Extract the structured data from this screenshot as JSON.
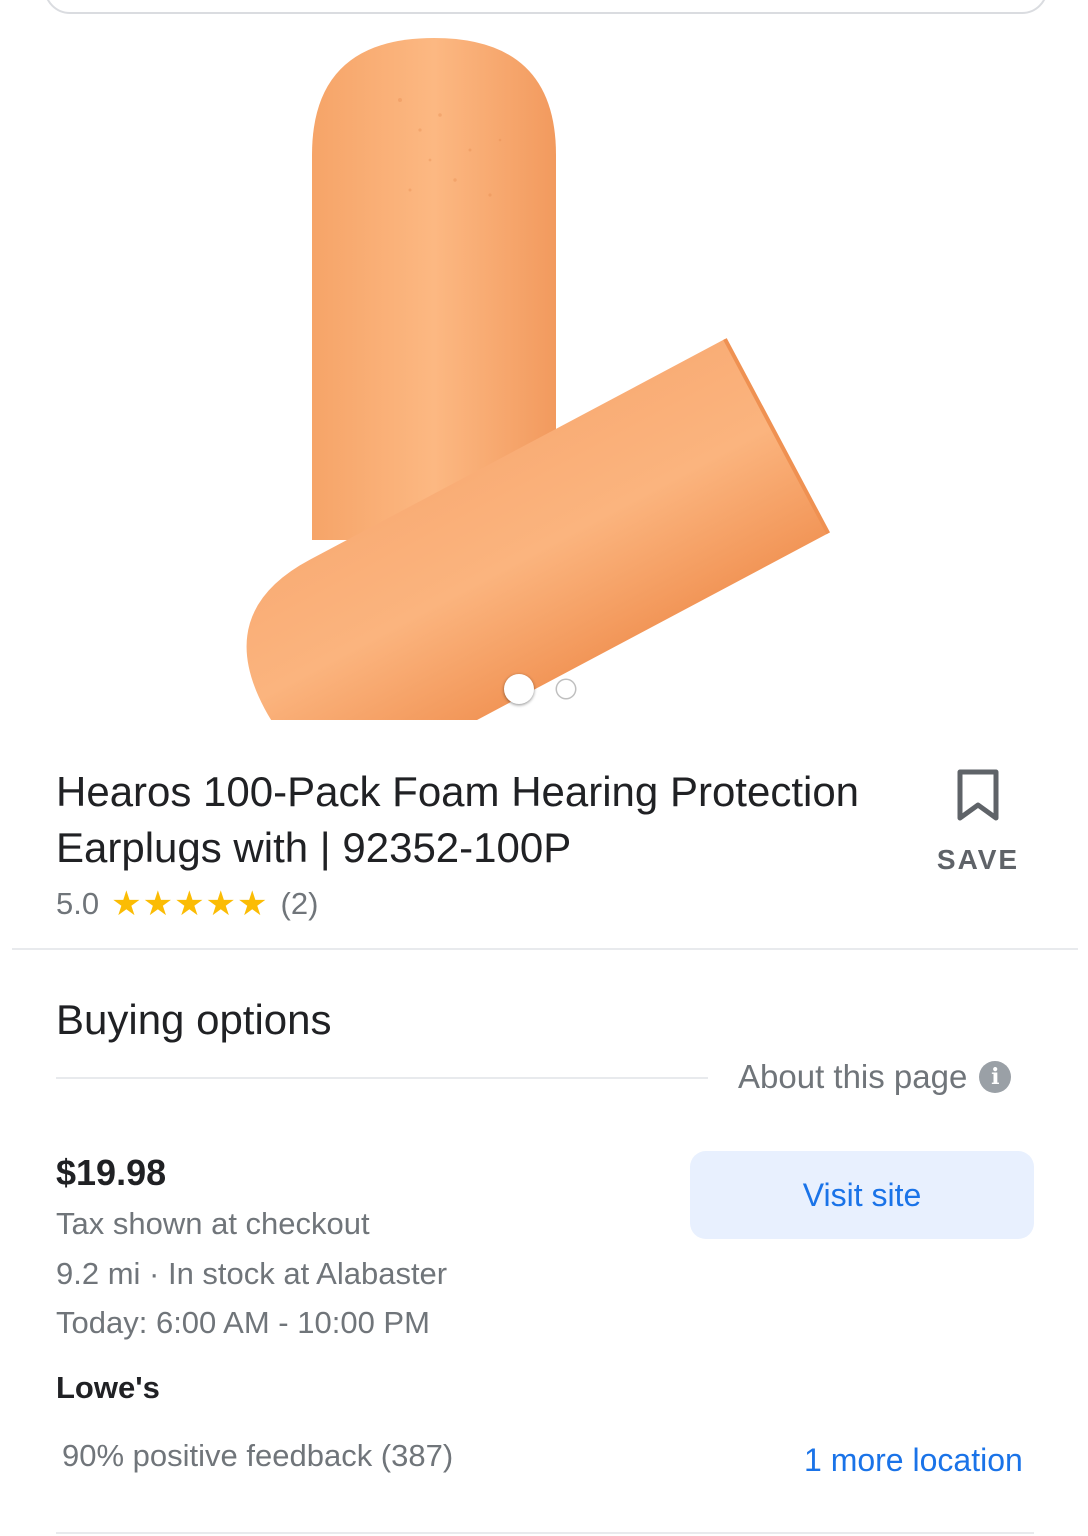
{
  "product": {
    "image_alt": "orange foam earplugs",
    "title": "Hearos 100-Pack Foam Hearing Protection Earplugs with | 92352-100P",
    "rating": "5.0",
    "stars": "★★★★★",
    "review_count": "(2)",
    "save_label": "SAVE",
    "carousel": {
      "total": 2,
      "active": 1
    }
  },
  "buying": {
    "section_title": "Buying options",
    "about_label": "About this page",
    "offer": {
      "price": "$19.98",
      "tax_note": "Tax shown at checkout",
      "stock": "9.2 mi · In stock at Alabaster",
      "hours": "Today: 6:00 AM - 10:00 PM",
      "visit_label": "Visit site",
      "seller": "Lowe's",
      "feedback": "90% positive feedback (387)",
      "more_locations": "1 more location"
    }
  },
  "colors": {
    "accent": "#1a73e8",
    "star": "#fbbc04",
    "button_bg": "#e8f0fe",
    "earplug": "#f8a970"
  }
}
